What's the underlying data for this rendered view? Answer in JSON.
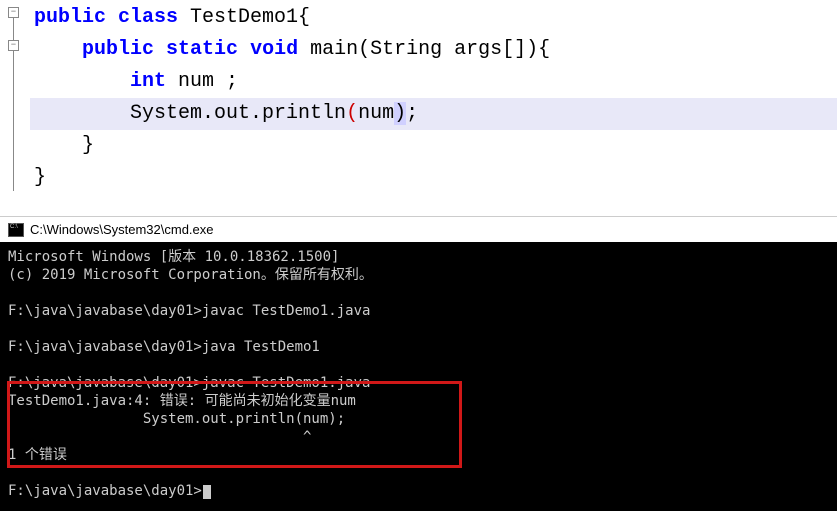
{
  "editor": {
    "lines": [
      {
        "tokens": [
          {
            "t": "kw",
            "v": "public class"
          },
          {
            "t": "plain",
            "v": " TestDemo1{"
          }
        ]
      },
      {
        "tokens": [
          {
            "t": "plain",
            "v": "    "
          },
          {
            "t": "kw",
            "v": "public static"
          },
          {
            "t": "plain",
            "v": " "
          },
          {
            "t": "type",
            "v": "void"
          },
          {
            "t": "plain",
            "v": " main(String args[]){"
          }
        ]
      },
      {
        "tokens": [
          {
            "t": "plain",
            "v": "        "
          },
          {
            "t": "type",
            "v": "int"
          },
          {
            "t": "plain",
            "v": " num ;"
          }
        ]
      },
      {
        "tokens": [
          {
            "t": "plain",
            "v": "        System.out.println"
          },
          {
            "t": "paren-red",
            "v": "("
          },
          {
            "t": "plain",
            "v": "num"
          },
          {
            "t": "paren-highlight",
            "v": ")"
          },
          {
            "t": "plain",
            "v": ";"
          }
        ],
        "highlight": true
      },
      {
        "tokens": [
          {
            "t": "plain",
            "v": "    }"
          }
        ]
      },
      {
        "tokens": [
          {
            "t": "plain",
            "v": "}"
          }
        ]
      }
    ]
  },
  "terminal": {
    "title": "C:\\Windows\\System32\\cmd.exe",
    "lines": [
      "Microsoft Windows [版本 10.0.18362.1500]",
      "(c) 2019 Microsoft Corporation。保留所有权利。",
      "",
      "F:\\java\\javabase\\day01>javac TestDemo1.java",
      "",
      "F:\\java\\javabase\\day01>java TestDemo1",
      "",
      "F:\\java\\javabase\\day01>javac TestDemo1.java",
      "TestDemo1.java:4: 错误: 可能尚未初始化变量num",
      "                System.out.println(num);",
      "                                   ^",
      "1 个错误",
      "",
      "F:\\java\\javabase\\day01>"
    ]
  }
}
